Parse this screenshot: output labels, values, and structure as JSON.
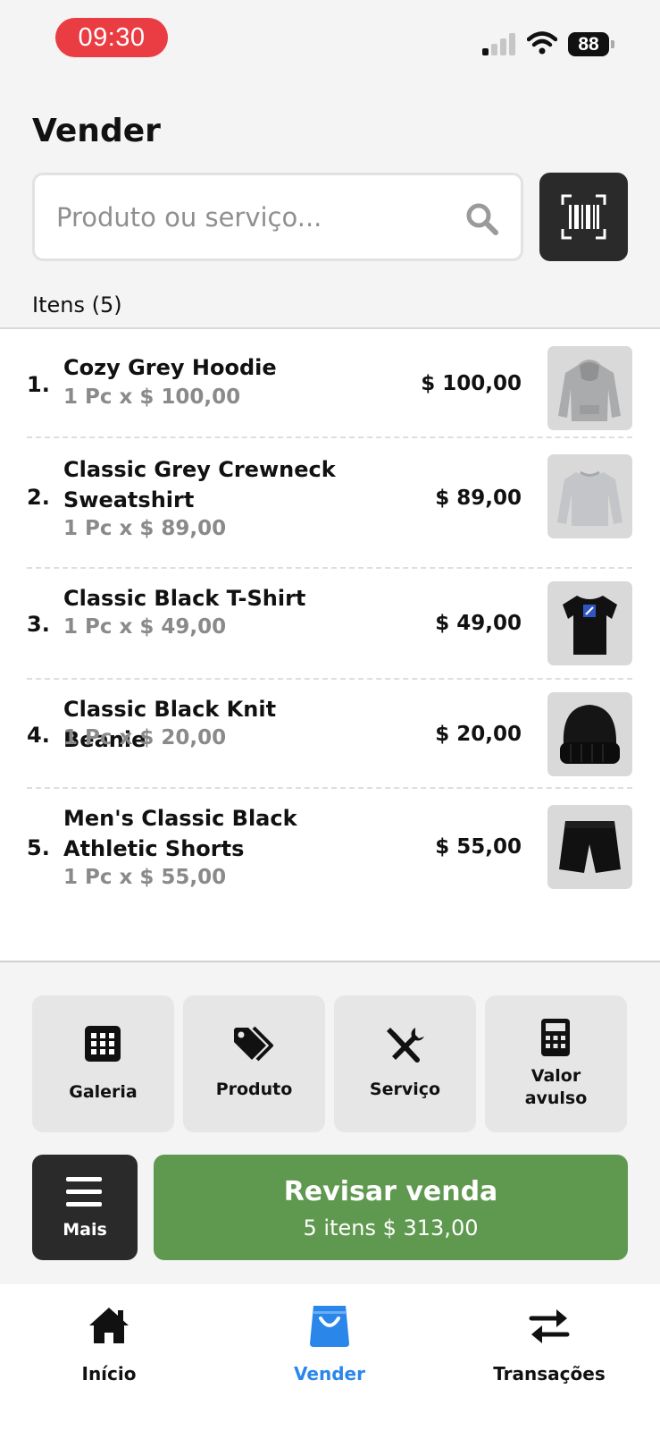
{
  "status_bar": {
    "time": "09:30",
    "battery": "88",
    "time_pill_color": "#ea3d43"
  },
  "header": {
    "title": "Vender",
    "search_placeholder": "Produto ou serviço...",
    "search_icon": "search-icon",
    "barcode_icon": "barcode-scan-icon"
  },
  "items": {
    "heading": "Itens (5)",
    "list": [
      {
        "index": "1.",
        "name": "Cozy Grey Hoodie",
        "qty": "1 Pc x $ 100,00",
        "total": "$ 100,00",
        "image": "grey-hoodie"
      },
      {
        "index": "2.",
        "name": "Classic Grey Crewneck Sweatshirt",
        "qty": "1 Pc x $ 89,00",
        "total": "$ 89,00",
        "image": "grey-sweatshirt"
      },
      {
        "index": "3.",
        "name": "Classic Black T-Shirt",
        "qty": "1 Pc x $ 49,00",
        "total": "$ 49,00",
        "image": "black-tshirt"
      },
      {
        "index": "4.",
        "name": "Classic Black Knit Beanie",
        "qty": "1 Pc x $ 20,00",
        "total": "$ 20,00",
        "image": "black-beanie"
      },
      {
        "index": "5.",
        "name": "Men's Classic Black Athletic Shorts",
        "qty": "1 Pc x $ 55,00",
        "total": "$ 55,00",
        "image": "black-shorts"
      }
    ]
  },
  "actions": {
    "tiles": [
      {
        "label": "Galeria",
        "icon": "grid-icon"
      },
      {
        "label": "Produto",
        "icon": "tags-icon"
      },
      {
        "label": "Serviço",
        "icon": "tools-icon"
      },
      {
        "label": "Valor avulso",
        "icon": "calculator-icon"
      }
    ],
    "more_label": "Mais",
    "more_icon": "menu-icon",
    "review_title": "Revisar venda",
    "review_summary": "5 itens $ 313,00",
    "review_color": "#5f994f"
  },
  "bottom_nav": {
    "items": [
      {
        "label": "Início",
        "icon": "home-icon",
        "active": false
      },
      {
        "label": "Vender",
        "icon": "shopping-bag-icon",
        "active": true
      },
      {
        "label": "Transações",
        "icon": "transfer-arrows-icon",
        "active": false
      }
    ],
    "active_color": "#2b86ea"
  }
}
